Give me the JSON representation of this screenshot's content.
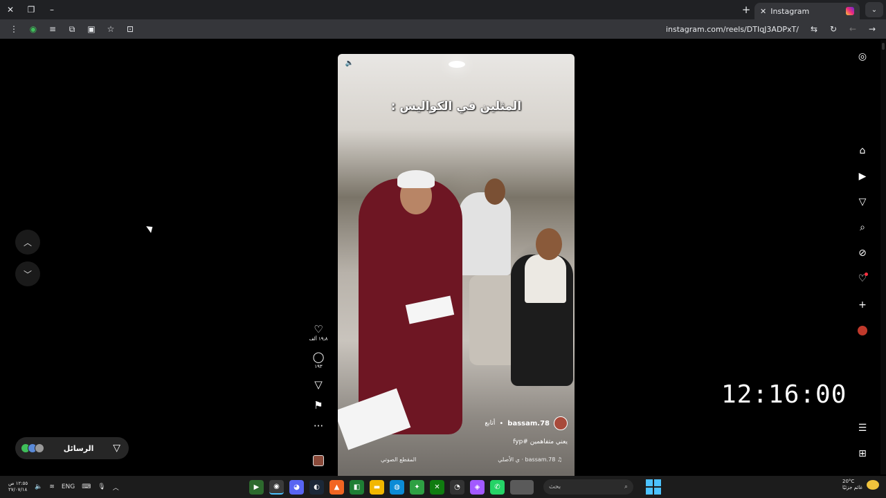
{
  "browser": {
    "tab_title": "Instagram",
    "url": "instagram.com/reels/DTIqJ3ADPxT/",
    "icons": {
      "close_window": "close-icon",
      "restore": "restore-icon",
      "minimize": "minimize-icon",
      "new_tab": "plus-icon",
      "tab_search": "chevron-down-icon"
    }
  },
  "reel": {
    "caption": "المثلين في الكواليس :",
    "username": "bassam.78",
    "follow_label": "أتابع",
    "description": "يعني متفاهمين #fyp",
    "audio": "bassam.78 · ي الأصلي",
    "sound_label": "المقطع الصوتي",
    "likes": "١٩٫٨ ألف",
    "comments": "١٩٣"
  },
  "messages": {
    "label": "الرسائل"
  },
  "clock": "12:16:00",
  "taskbar": {
    "time": "١٢:٥٥ ص",
    "date": "٢٧/٠٧/١٨",
    "lang": "ENG",
    "search_placeholder": "بحث",
    "weather_temp": "20°C",
    "weather_desc": "غائم جزئيًا"
  },
  "colors": {
    "background": "#000000",
    "accent": "#ff3040",
    "chrome": "#35363a"
  }
}
